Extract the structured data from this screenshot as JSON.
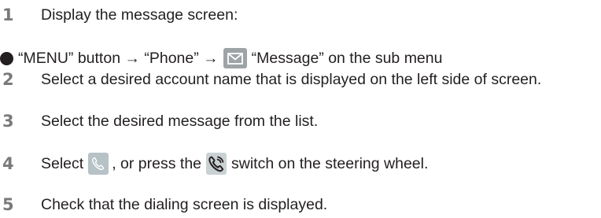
{
  "steps": [
    {
      "number": "1",
      "text": "Display the message screen:"
    },
    {
      "number": "2",
      "text": "Select a desired account name that is displayed on the left side of screen."
    },
    {
      "number": "3",
      "text": "Select the desired message from the list."
    },
    {
      "number": "4",
      "text_before": "Select",
      "text_middle": ", or press the",
      "text_after": "switch on the steering wheel."
    },
    {
      "number": "5",
      "text": "Check that the dialing screen is displayed."
    }
  ],
  "bullet": {
    "part1": "“MENU” button → “Phone” →",
    "part2": "“Message” on the sub menu"
  },
  "icons": {
    "message": "envelope-icon",
    "phone_screen": "phone-icon",
    "steering_switch": "phone-switch-icon"
  },
  "colors": {
    "text": "#231f20",
    "step_number": "#7a7a7a",
    "icon_bg": "#9ea3a6"
  }
}
